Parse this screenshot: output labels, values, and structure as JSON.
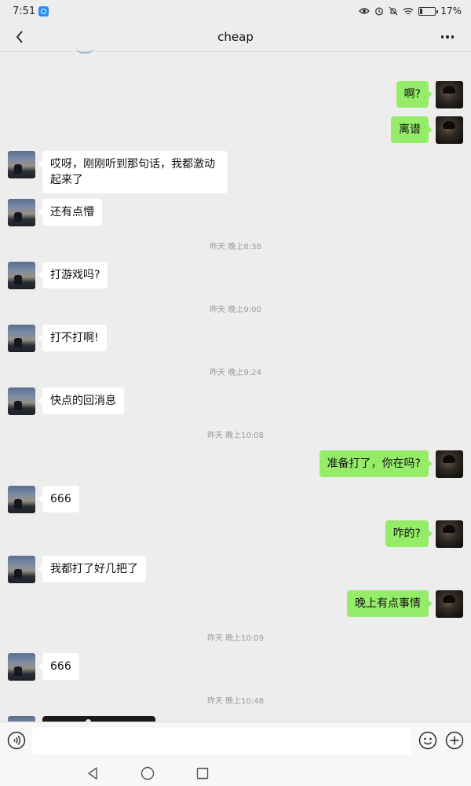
{
  "status_bar": {
    "time": "7:51",
    "battery": "17%",
    "battery_level": 0.17
  },
  "header": {
    "title": "cheap"
  },
  "messages": [
    {
      "side": "right",
      "text": "啊?"
    },
    {
      "side": "right",
      "text": "离谱"
    },
    {
      "side": "left",
      "text": "哎呀，刚刚听到那句话，我都激动起来了"
    },
    {
      "side": "left",
      "text": "还有点懵"
    },
    {
      "timestamp": "昨天 晚上8:38"
    },
    {
      "side": "left",
      "text": "打游戏吗?"
    },
    {
      "timestamp": "昨天 晚上9:00"
    },
    {
      "side": "left",
      "text": "打不打啊!"
    },
    {
      "timestamp": "昨天 晚上9:24"
    },
    {
      "side": "left",
      "text": "快点的回消息"
    },
    {
      "timestamp": "昨天 晚上10:08"
    },
    {
      "side": "right",
      "text": "准备打了，你在吗?"
    },
    {
      "side": "left",
      "text": "666"
    },
    {
      "side": "right",
      "text": "咋的?"
    },
    {
      "side": "left",
      "text": "我都打了好几把了"
    },
    {
      "side": "right",
      "text": "晚上有点事情"
    },
    {
      "timestamp": "昨天 晚上10:09"
    },
    {
      "side": "left",
      "text": "666"
    },
    {
      "timestamp": "昨天 晚上10:48"
    },
    {
      "side": "left",
      "image": true
    }
  ],
  "input_bar": {
    "value": "",
    "placeholder": "",
    "voice_icon": "voice-icon",
    "emoji_icon": "emoji-icon",
    "plus_icon": "plus-icon"
  },
  "nav_bar": {
    "back_icon": "triangle-back-icon",
    "home_icon": "circle-home-icon",
    "recent_icon": "square-recent-icon"
  },
  "colors": {
    "background": "#ededed",
    "bubble_sent": "#95ec69",
    "bubble_received": "#ffffff",
    "timestamp": "#9a9a9a"
  }
}
